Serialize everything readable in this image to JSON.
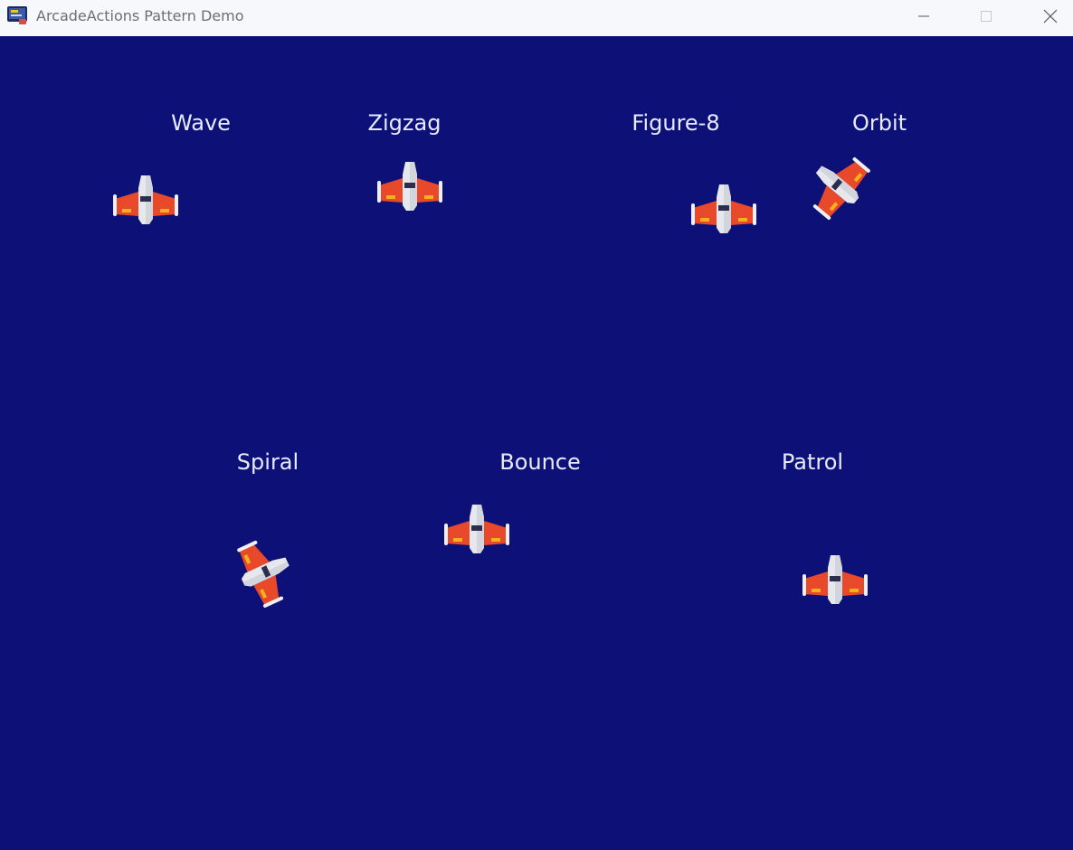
{
  "window": {
    "title": "ArcadeActions Pattern Demo",
    "controls": [
      "minimize-icon",
      "maximize-icon",
      "close-icon"
    ]
  },
  "scene": {
    "background_color": "#0d1076",
    "label_color": "#e8ebff",
    "ship_icon": "spaceship-icon",
    "patterns": [
      {
        "name": "Wave"
      },
      {
        "name": "Zigzag"
      },
      {
        "name": "Figure-8"
      },
      {
        "name": "Orbit"
      },
      {
        "name": "Spiral"
      },
      {
        "name": "Bounce"
      },
      {
        "name": "Patrol"
      }
    ]
  }
}
